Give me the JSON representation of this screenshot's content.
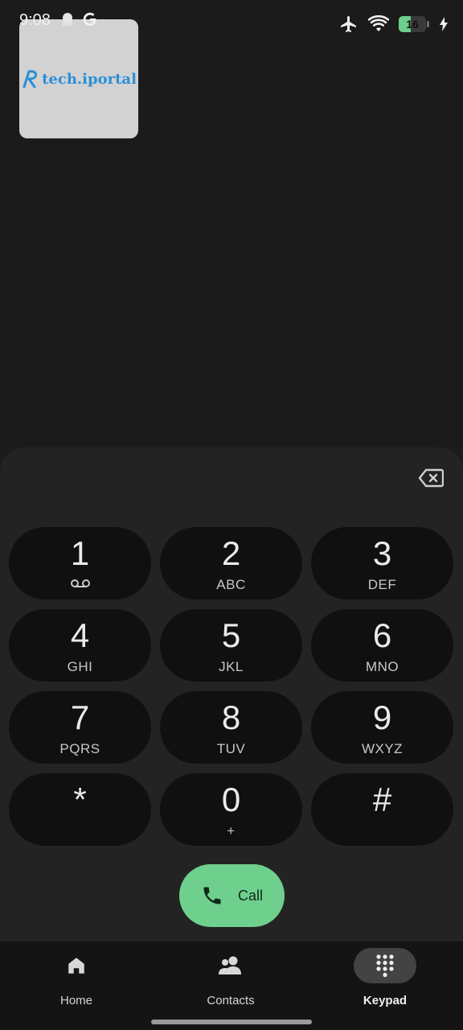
{
  "status_bar": {
    "time": "9:08",
    "battery_level": "16",
    "battery_fraction": 0.45
  },
  "pip_overlay": {
    "logo_text": "tech.iportal",
    "logo_mark": "R"
  },
  "dialer": {
    "keys": [
      {
        "digit": "1",
        "letters": "",
        "sub_icon": "voicemail-icon"
      },
      {
        "digit": "2",
        "letters": "ABC"
      },
      {
        "digit": "3",
        "letters": "DEF"
      },
      {
        "digit": "4",
        "letters": "GHI"
      },
      {
        "digit": "5",
        "letters": "JKL"
      },
      {
        "digit": "6",
        "letters": "MNO"
      },
      {
        "digit": "7",
        "letters": "PQRS"
      },
      {
        "digit": "8",
        "letters": "TUV"
      },
      {
        "digit": "9",
        "letters": "WXYZ"
      },
      {
        "digit": "*",
        "letters": ""
      },
      {
        "digit": "0",
        "letters": "+"
      },
      {
        "digit": "#",
        "letters": ""
      }
    ],
    "call_label": "Call",
    "accent_color": "#6fd08e"
  },
  "nav": {
    "items": [
      {
        "label": "Home",
        "icon": "home-icon",
        "active": false
      },
      {
        "label": "Contacts",
        "icon": "contacts-icon",
        "active": false
      },
      {
        "label": "Keypad",
        "icon": "keypad-icon",
        "active": true
      }
    ]
  }
}
